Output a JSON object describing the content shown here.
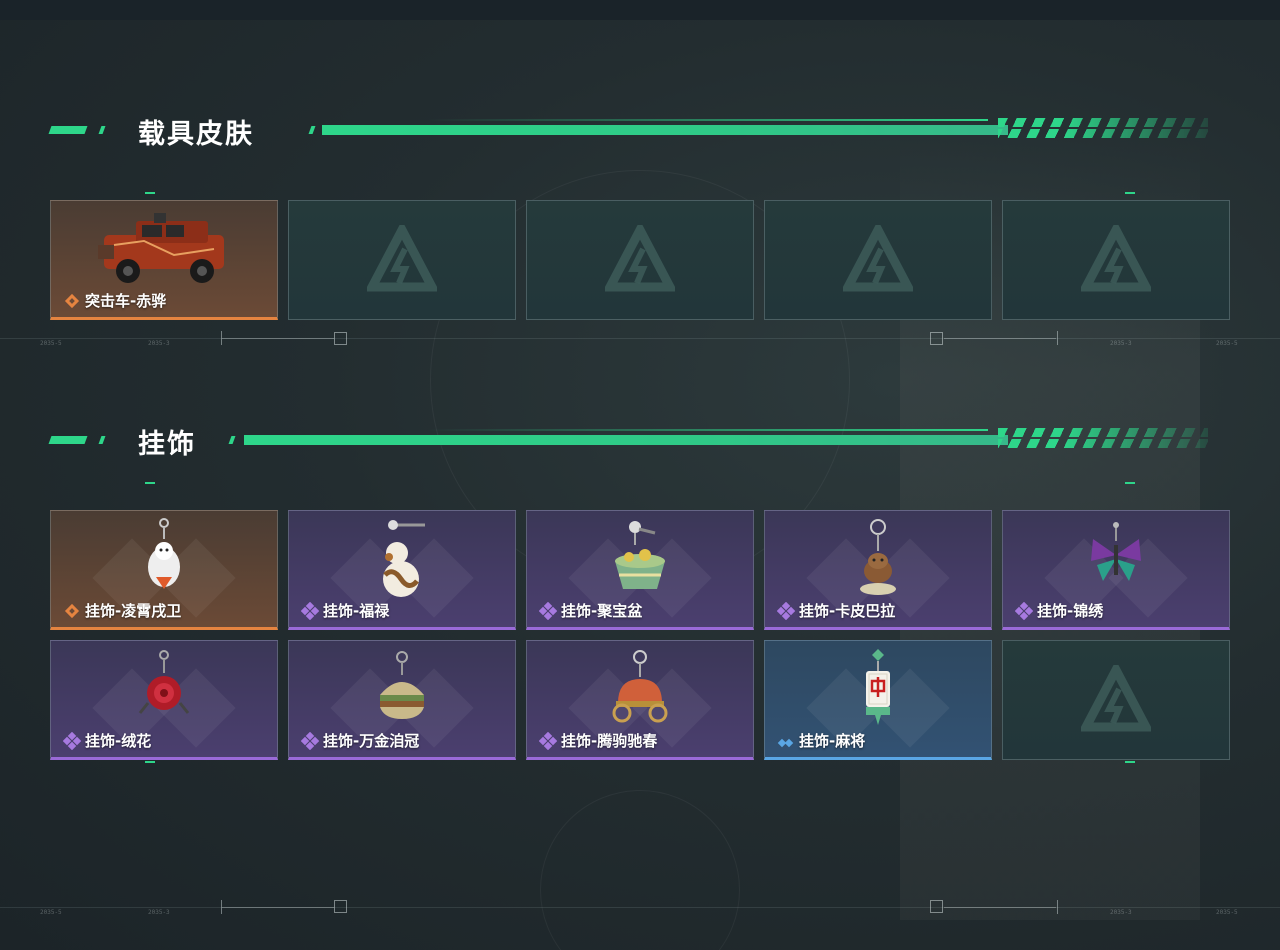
{
  "colors": {
    "accent_green": "#2ed68a",
    "rarity_orange": "#e58440",
    "rarity_purple": "#9a6ad8",
    "rarity_blue": "#5aa6e4"
  },
  "sections": [
    {
      "title": "载具皮肤",
      "items": [
        {
          "name": "突击车-赤骅",
          "rarity": "orange",
          "icon": "assault-vehicle-icon"
        },
        {
          "name": "",
          "rarity": "empty"
        },
        {
          "name": "",
          "rarity": "empty"
        },
        {
          "name": "",
          "rarity": "empty"
        },
        {
          "name": "",
          "rarity": "empty"
        }
      ]
    },
    {
      "title": "挂饰",
      "items": [
        {
          "name": "挂饰-凌霄戌卫",
          "rarity": "orange",
          "icon": "dog-charm-icon"
        },
        {
          "name": "挂饰-福禄",
          "rarity": "purple",
          "icon": "gourd-charm-icon"
        },
        {
          "name": "挂饰-聚宝盆",
          "rarity": "purple",
          "icon": "treasure-bowl-charm-icon"
        },
        {
          "name": "挂饰-卡皮巴拉",
          "rarity": "purple",
          "icon": "capybara-charm-icon"
        },
        {
          "name": "挂饰-锦绣",
          "rarity": "purple",
          "icon": "butterfly-charm-icon"
        },
        {
          "name": "挂饰-绒花",
          "rarity": "purple",
          "icon": "rose-charm-icon"
        },
        {
          "name": "挂饰-万金洎冠",
          "rarity": "purple",
          "icon": "burger-charm-icon"
        },
        {
          "name": "挂饰-腾驹驰春",
          "rarity": "purple",
          "icon": "carriage-charm-icon"
        },
        {
          "name": "挂饰-麻将",
          "rarity": "blue",
          "icon": "mahjong-charm-icon"
        },
        {
          "name": "",
          "rarity": "empty"
        }
      ]
    }
  ]
}
